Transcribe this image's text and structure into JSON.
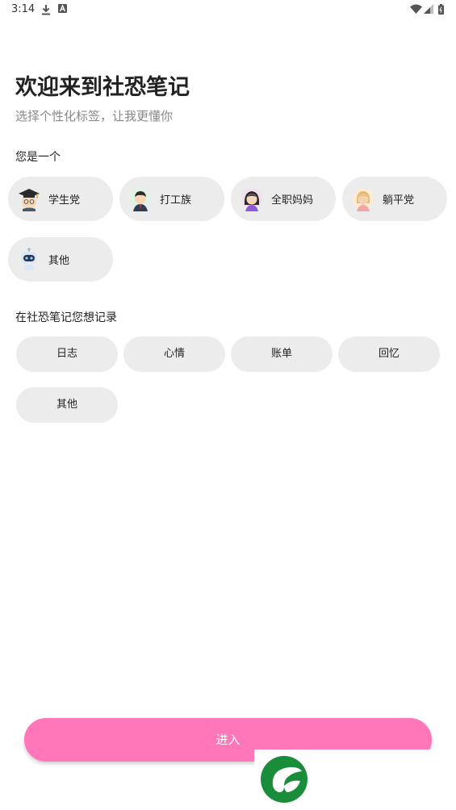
{
  "status_bar": {
    "time": "3:14"
  },
  "header": {
    "title": "欢迎来到社恐笔记",
    "subtitle": "选择个性化标签，让我更懂你"
  },
  "identity": {
    "label": "您是一个",
    "options": [
      {
        "label": "学生党",
        "icon": "student-avatar-icon"
      },
      {
        "label": "打工族",
        "icon": "worker-avatar-icon"
      },
      {
        "label": "全职妈妈",
        "icon": "mom-avatar-icon"
      },
      {
        "label": "躺平党",
        "icon": "lying-flat-avatar-icon"
      },
      {
        "label": "其他",
        "icon": "robot-avatar-icon"
      }
    ]
  },
  "records": {
    "label": "在社恐笔记您想记录",
    "options": [
      "日志",
      "心情",
      "账单",
      "回忆",
      "其他"
    ]
  },
  "enter_button": {
    "label": "进入",
    "color": "#ff77b8"
  },
  "colors": {
    "pill_bg": "#ececec",
    "accent": "#ff77b8",
    "subtitle": "#888888"
  }
}
